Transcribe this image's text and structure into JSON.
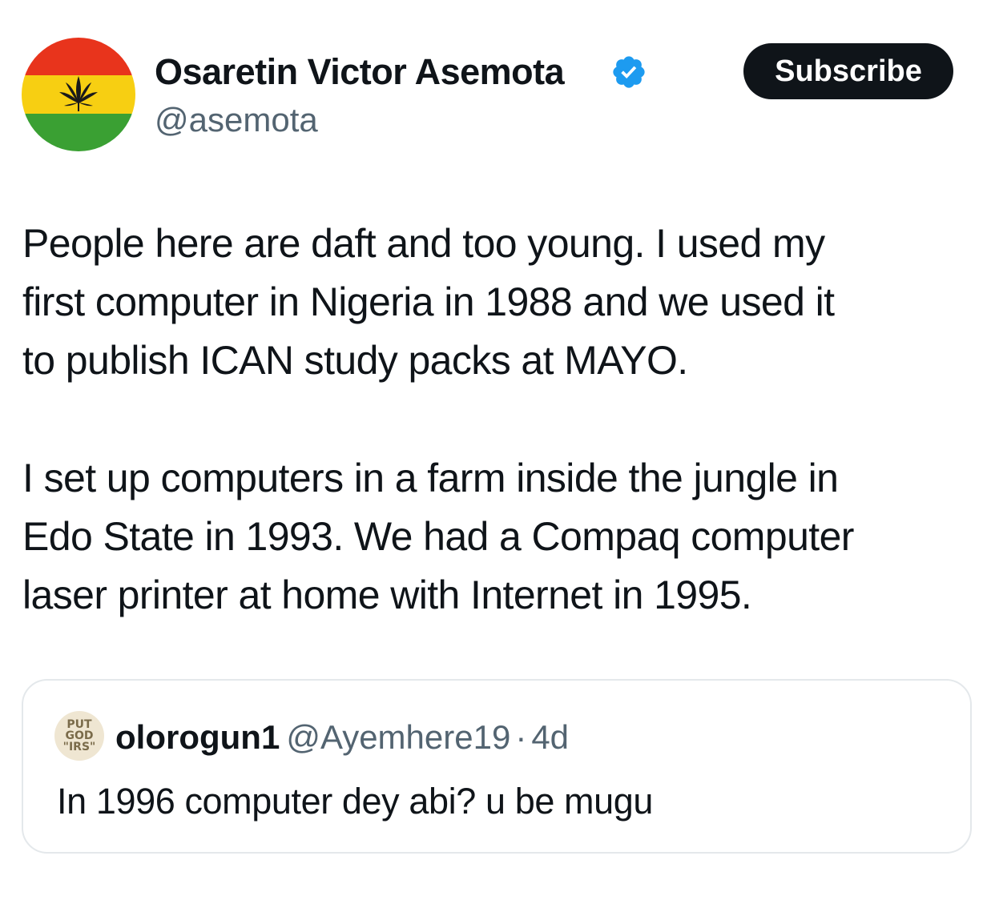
{
  "author": {
    "name": "Osaretin Victor Asemota",
    "handle": "@asemota",
    "verified": true,
    "avatar_icon": "red-yellow-green-flag-leaf-avatar"
  },
  "subscribe": {
    "label": "Subscribe"
  },
  "tweet": {
    "paragraph1": [
      "People here are daft and too young. I used my",
      "first computer in Nigeria in 1988 and we used it",
      "to publish ICAN study packs at MAYO."
    ],
    "paragraph2": [
      "I set up computers in a farm inside the jungle in",
      "Edo State in 1993. We had a Compaq computer",
      "laser printer at home with Internet in 1995."
    ]
  },
  "quote": {
    "name": "olorogun1",
    "handle": "@Ayemhere19",
    "separator": "·",
    "time": "4d",
    "text": "In 1996 computer dey abi? u be mugu",
    "avatar_text": [
      "PUT",
      "GOD",
      "\"IRS\""
    ]
  },
  "colors": {
    "verified_blue": "#1d9bf0",
    "button_bg": "#0f1419",
    "secondary_text": "#536471",
    "border": "#e4e8eb"
  }
}
